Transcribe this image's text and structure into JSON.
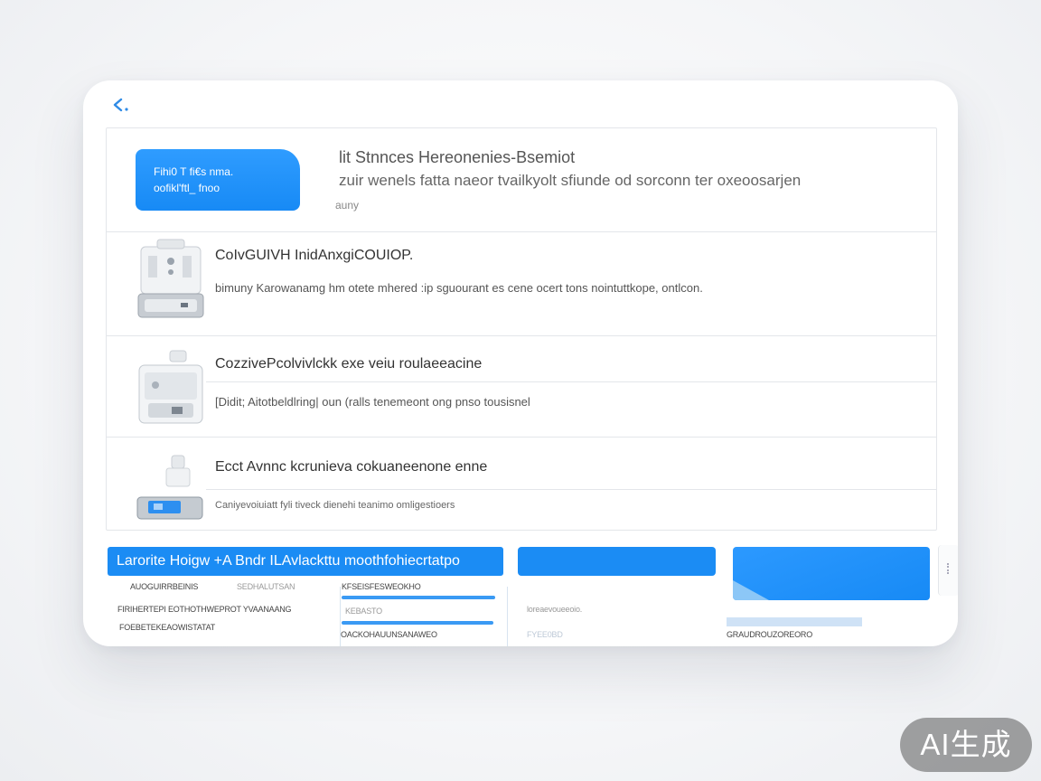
{
  "hero": {
    "button_line1": "Fihi0 T fi€s nma.",
    "button_line2": "oofikl'ftl_ fnoo",
    "title": "lit Stnnces Hereonenies-Bsemiot",
    "description": "zuir wenels fatta naeor tvailkyolt sfiunde od sorconn ter oxeoosarjen",
    "sub": "auny"
  },
  "items": [
    {
      "title": "CoIvGUIVH InidAnxgiCOUIOP.",
      "description": "bimuny Karowanamg hm otete  mhered :ip sguourant es cene ocert tons nointuttkope, ontlcon."
    },
    {
      "title": "CozzivePcolvivlckk exe veiu roulaeeacine",
      "description": "[Didit; Aitotbeldlring| oun (ralls tenemeont ong pnso tousisnel"
    },
    {
      "title": "Ecct Avnnc kcrunieva cokuaneenone enne",
      "description": "Caniyevoiuiatt fyli tiveck dienehi  teanimo omligestioers"
    }
  ],
  "bottom": {
    "tab_main": "Larorite Hoigw +A Bndr ILAvlackttu moothfohiecrtatpo",
    "col1": [
      "AUOGUIRRBEINIS",
      "FIRIHERTEPI EOTHOTHWEPROT YVAANAANG",
      "FOEBETEKEAOWISTATAT"
    ],
    "col1_muted": "SEDHALUTSAN",
    "col2": [
      "KFSEISFESWEOKHO",
      "KEBASTO",
      "OACKOHAUUNSANAWEO"
    ],
    "col3": [
      "loreaevoueeoio.",
      "FYEE0BD"
    ],
    "col4": [
      "GRAUDROUZOREORO"
    ]
  },
  "badge": "AI生成"
}
